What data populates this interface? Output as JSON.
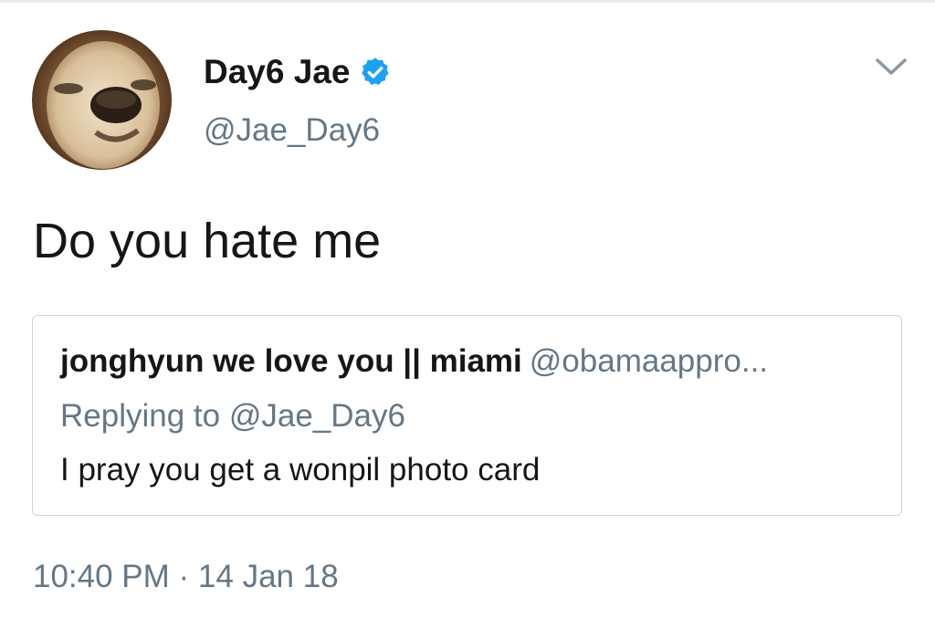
{
  "tweet": {
    "author": {
      "display_name": "Day6 Jae",
      "handle": "@Jae_Day6",
      "verified": true,
      "avatar_icon": "chihuahua-avatar"
    },
    "text": "Do you hate me",
    "timestamp": "10:40 PM · 14 Jan 18",
    "menu_icon": "chevron-down-icon"
  },
  "quoted_tweet": {
    "display_name": "jonghyun we love you || miami",
    "handle": "@obamaappro...",
    "replying_prefix": "Replying to",
    "replying_handle": "@Jae_Day6",
    "text": "I pray you get a wonpil photo card"
  },
  "colors": {
    "text_primary": "#14171a",
    "text_secondary": "#657786",
    "verified_blue": "#1da1f2",
    "border": "#ccd6dd"
  }
}
